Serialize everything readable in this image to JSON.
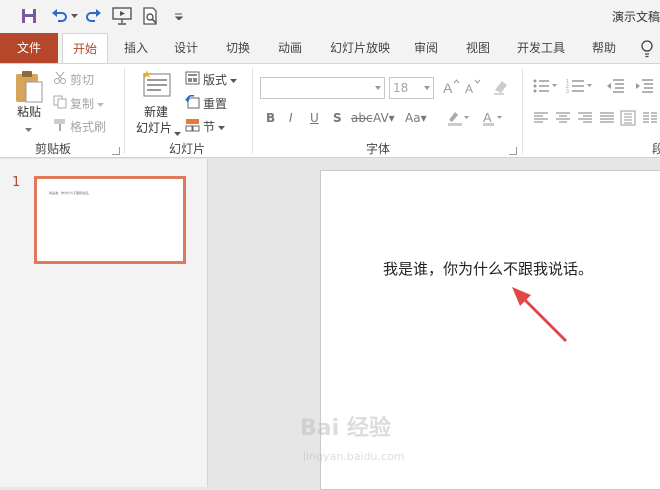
{
  "window": {
    "title": "演示文稿"
  },
  "tabs": [
    "文件",
    "开始",
    "插入",
    "设计",
    "切换",
    "动画",
    "幻灯片放映",
    "审阅",
    "视图",
    "开发工具",
    "帮助"
  ],
  "ribbon": {
    "clipboard": {
      "label": "剪贴板",
      "paste": "粘贴",
      "cut": "剪切",
      "copy": "复制",
      "format_painter": "格式刷"
    },
    "slides": {
      "label": "幻灯片",
      "new_slide_line1": "新建",
      "new_slide_line2": "幻灯片",
      "layout": "版式",
      "reset": "重置",
      "section": "节"
    },
    "font": {
      "label": "字体",
      "font_name": "",
      "font_size": "18"
    },
    "paragraph": {
      "label": "段"
    }
  },
  "thumbnails": [
    {
      "number": "1",
      "text": "我是谁，你为什么不跟我说话。"
    }
  ],
  "slide": {
    "text": "我是谁，你为什么不跟我说话。"
  },
  "watermark": {
    "logo": "Bai 经验",
    "url": "jingyan.baidu.com"
  },
  "colors": {
    "accent": "#b7472a",
    "arrow": "#e04848",
    "thumb_border": "#e0785a"
  }
}
